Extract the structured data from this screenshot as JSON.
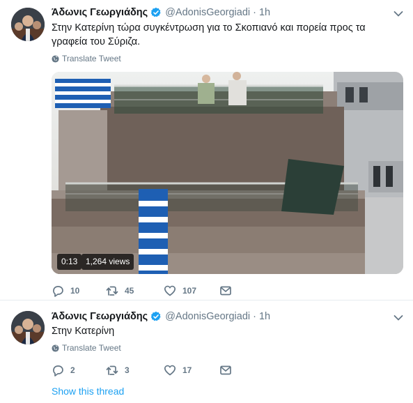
{
  "tweets": [
    {
      "author": "Άδωνις Γεωργιάδης",
      "handle": "@AdonisGeorgiadi",
      "separator": "·",
      "time": "1h",
      "text": "Στην Κατερίνη τώρα συγκέντρωση για το Σκοπιανό και πορεία προς τα γραφεία του Σύριζα.",
      "translate_label": "Translate Tweet",
      "video": {
        "duration": "0:13",
        "views": "1,264 views"
      },
      "replies": "10",
      "retweets": "45",
      "likes": "107"
    },
    {
      "author": "Άδωνις Γεωργιάδης",
      "handle": "@AdonisGeorgiadi",
      "separator": "·",
      "time": "1h",
      "text": "Στην Κατερίνη",
      "translate_label": "Translate Tweet",
      "replies": "2",
      "retweets": "3",
      "likes": "17",
      "show_thread": "Show this thread"
    }
  ],
  "icons": {
    "verified": "verified-badge-icon",
    "caret": "chevron-down-icon",
    "globe": "globe-icon",
    "reply": "reply-icon",
    "retweet": "retweet-icon",
    "like": "heart-icon",
    "dm": "envelope-icon"
  },
  "colors": {
    "link": "#1da1f2",
    "muted": "#657786",
    "text": "#14171a",
    "divider": "#e6ecf0"
  }
}
